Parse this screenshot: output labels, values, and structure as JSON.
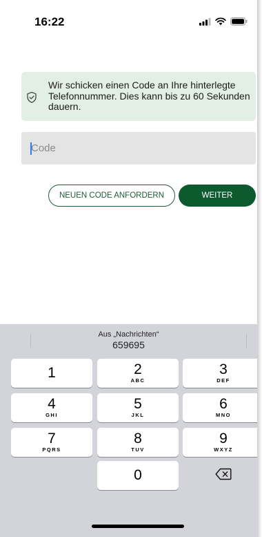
{
  "status_bar": {
    "time": "16:22",
    "icons": [
      "cellular-signal-icon",
      "wifi-icon",
      "battery-icon"
    ]
  },
  "info_banner": {
    "icon": "shield-check-icon",
    "text": "Wir schicken einen Code an Ihre hinterlegte Telefonnummer. Dies kann bis zu 60 Sekunden dauern."
  },
  "code_input": {
    "placeholder": "Code",
    "value": ""
  },
  "buttons": {
    "request_new_code": "NEUEN CODE ANFORDERN",
    "continue": "WEITER"
  },
  "keyboard": {
    "suggestion": {
      "source": "Aus „Nachrichten“",
      "code": "659695"
    },
    "keys": [
      {
        "digit": "1",
        "letters": ""
      },
      {
        "digit": "2",
        "letters": "ABC"
      },
      {
        "digit": "3",
        "letters": "DEF"
      },
      {
        "digit": "4",
        "letters": "GHI"
      },
      {
        "digit": "5",
        "letters": "JKL"
      },
      {
        "digit": "6",
        "letters": "MNO"
      },
      {
        "digit": "7",
        "letters": "PQRS"
      },
      {
        "digit": "8",
        "letters": "TUV"
      },
      {
        "digit": "9",
        "letters": "WXYZ"
      },
      {
        "digit": "0",
        "letters": ""
      }
    ],
    "delete_icon": "backspace-icon"
  },
  "colors": {
    "brand_green": "#0e5a2f",
    "banner_bg": "#e3efe4",
    "input_bg": "#e4e4e4",
    "keyboard_bg": "#d2d4d9",
    "caret": "#2f7bf5"
  }
}
